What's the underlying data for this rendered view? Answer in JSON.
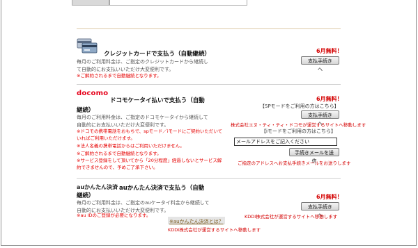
{
  "credit": {
    "title": "クレジットカードで支払う（自動継続）",
    "desc_line1": "毎月のご利用料金は、ご指定のクレジットカードから継続し",
    "desc_line2": "て自動的にお支払いいただけ大変便利です。",
    "note": "※ご解約されるまで自動継続となります。",
    "free_label": "6月無料！",
    "button": "支払手続きへ"
  },
  "docomo": {
    "logo": "docomo",
    "title_line1": "ドコモケータイ払いで支払う（自動",
    "title_line2": "継続）",
    "desc_line1": "毎月のご利用料金は、ご指定のドコモケータイから継続して",
    "desc_line2": "自動的にお支払いいただけ大変便利です。",
    "notes": [
      "※ドコモの携帯電話をおもちで、spモード／iモードにご契約いただいて",
      "いればご利用いただけます。",
      "※法人名義の携帯電話からはご利用いただけません。",
      "※ご解約されるまで自動継続となります。",
      "※サービス登録をして頂いてから「20分程度」経過しないとサービス解",
      "約できませんので、予めご了承下さい。"
    ],
    "free_label": "6月無料！",
    "sp_mode_label": "【SPモードをご利用の方はこちら】",
    "sp_button": "支払手続きへ",
    "sp_note": "株式会社エヌ・ティ・ティ・ドコモが運営するサイトへ移動します",
    "i_mode_label": "【iモードをご利用の方はこちら】",
    "email_placeholder": "メールアドレスをご記入ください",
    "email_button": "手続きメールを送信",
    "email_note": "ご指定のアドレスへお支払手続きメールをお送りします"
  },
  "au": {
    "logo": "auかんたん決済",
    "title_line1": "auかんたん決済で支払う（自動",
    "title_line2": "継続）",
    "desc_line1": "毎月のご利用料金は、ご指定のauケータイ料金から継続して",
    "desc_line2": "自動的にお支払いいただけ大変便利です。",
    "note": "※au IDのご登録が必要になります。",
    "link": "※auかんたん決済とは？",
    "link_note": "KDDI株式会社が運営するサイトへ移動します",
    "free_label": "6月無料！",
    "button": "支払手続きへ",
    "button_note": "KDDI株式会社が運営するサイトへ移動します"
  }
}
